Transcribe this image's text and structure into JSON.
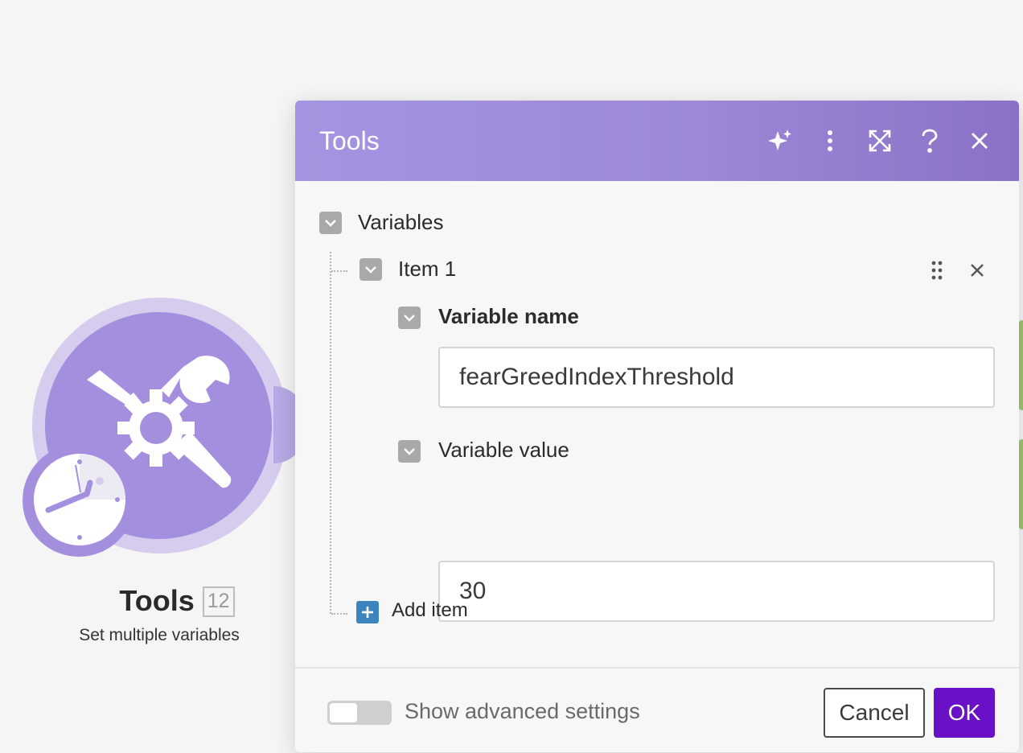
{
  "canvas": {
    "module": {
      "icon": "tools-icon",
      "badge_icon": "clock-icon",
      "title": "Tools",
      "id_label": "12",
      "subtitle": "Set multiple variables",
      "color": "#a48fdf"
    }
  },
  "dialog": {
    "title": "Tools",
    "header_color": "#9c88d7",
    "header_icons": [
      "sparkles-icon",
      "more-vertical-icon",
      "expand-icon",
      "help-icon",
      "close-icon"
    ],
    "section_label": "Variables",
    "item": {
      "label": "Item 1",
      "fields": [
        {
          "label": "Variable name",
          "value": "fearGreedIndexThreshold"
        },
        {
          "label": "Variable value",
          "value": "30"
        }
      ]
    },
    "add_item_label": "Add item",
    "footer": {
      "advanced_toggle_label": "Show advanced settings",
      "advanced_toggle_on": false,
      "cancel_label": "Cancel",
      "ok_label": "OK",
      "ok_color": "#6a11c8"
    }
  }
}
